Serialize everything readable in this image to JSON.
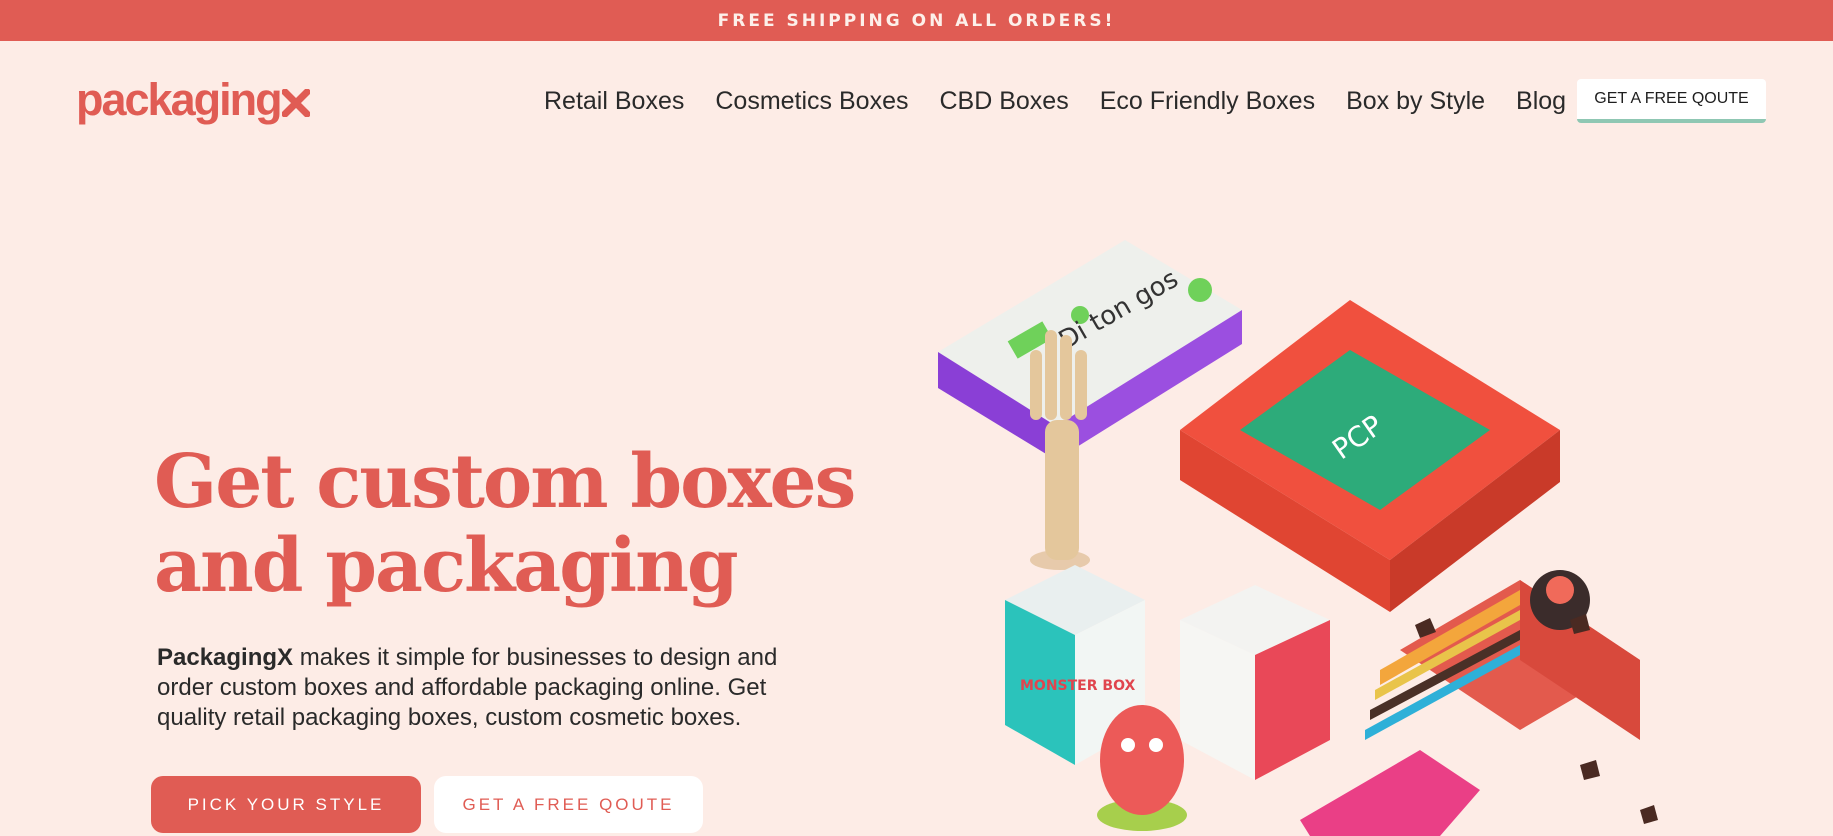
{
  "announcement": {
    "text": "FREE SHIPPING ON ALL ORDERS!"
  },
  "brand": {
    "logo_text": "packaging",
    "logo_icon": "x-mark-icon",
    "color": "#e05c54"
  },
  "nav": {
    "items": [
      {
        "label": "Retail Boxes"
      },
      {
        "label": "Cosmetics Boxes"
      },
      {
        "label": "CBD Boxes"
      },
      {
        "label": "Eco Friendly Boxes"
      },
      {
        "label": "Box by Style"
      },
      {
        "label": "Blog"
      }
    ],
    "cta_label": "GET A FREE QOUTE"
  },
  "hero": {
    "title_line1": "Get custom boxes",
    "title_line2": "and packaging",
    "desc_brand": "PackagingX",
    "desc_rest": " makes it simple for businesses to design and order custom boxes and affordable packaging online. Get quality retail packaging boxes, custom cosmetic boxes.",
    "primary_button": "PICK YOUR STYLE",
    "secondary_button": "GET A FREE QOUTE"
  },
  "illustration": {
    "box1_title": "Di ton gos",
    "box2_title": "PCP",
    "box3_title": "MONSTER BOX"
  },
  "colors": {
    "accent": "#e05c54",
    "background": "#fdece6",
    "cta_underline": "#8fc7b3"
  }
}
